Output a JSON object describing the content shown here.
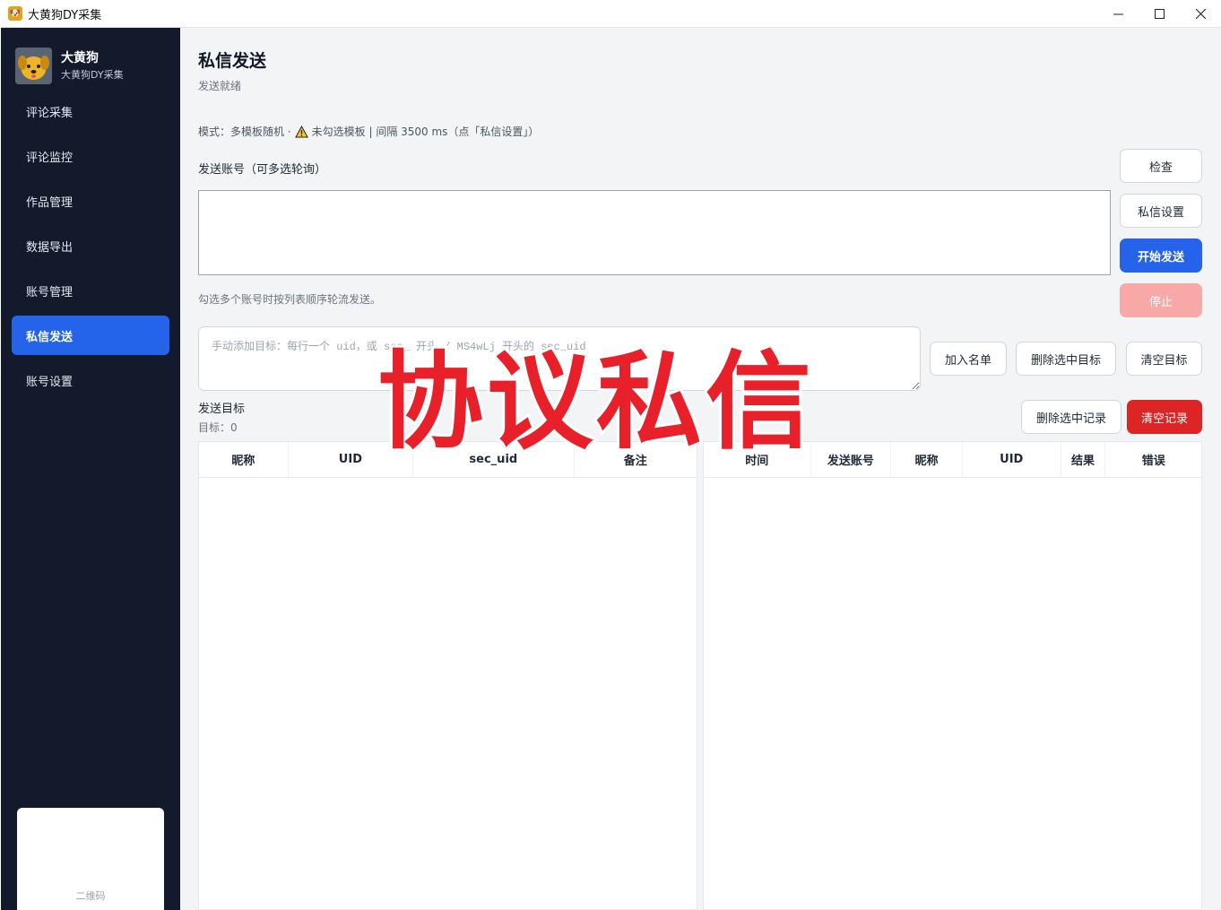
{
  "window": {
    "title": "大黄狗DY采集",
    "controls": {
      "minimize": "—",
      "maximize": "☐",
      "close": "✕"
    }
  },
  "sidebar": {
    "brand_name": "大黄狗",
    "brand_sub": "大黄狗DY采集",
    "items": [
      {
        "label": "评论采集"
      },
      {
        "label": "评论监控"
      },
      {
        "label": "作品管理"
      },
      {
        "label": "数据导出"
      },
      {
        "label": "账号管理"
      },
      {
        "label": "私信发送",
        "active": true
      },
      {
        "label": "账号设置"
      }
    ],
    "qr_label": "二维码"
  },
  "main": {
    "title": "私信发送",
    "status": "发送就绪",
    "mode_prefix": "模式：多模板随机 ·",
    "mode_suffix": "未勾选模板 | 间隔 3500 ms（点「私信设置」）",
    "account_label": "发送账号（可多选轮询）",
    "account_hint": "勾选多个账号时按列表顺序轮流发送。",
    "buttons": {
      "check": "检查",
      "dm_settings": "私信设置",
      "start": "开始发送",
      "stop": "停止",
      "add_list": "加入名单",
      "delete_selected_targets": "删除选中目标",
      "clear_targets": "清空目标",
      "delete_selected_records": "删除选中记录",
      "clear_records": "清空记录"
    },
    "target_placeholder": "手动添加目标：每行一个 uid，或 sec_ 开头 / MS4wLj 开头的 sec_uid",
    "targets_label": "发送目标",
    "targets_count": "目标：0",
    "targets_table": {
      "columns": [
        "昵称",
        "UID",
        "sec_uid",
        "备注"
      ]
    },
    "records_table": {
      "columns": [
        "时间",
        "发送账号",
        "昵称",
        "UID",
        "结果",
        "错误"
      ]
    }
  },
  "overlay_text": "协议私信",
  "colors": {
    "sidebar_bg": "#121a2b",
    "accent": "#2563eb",
    "danger": "#dc2626",
    "overlay": "#e8202a"
  }
}
